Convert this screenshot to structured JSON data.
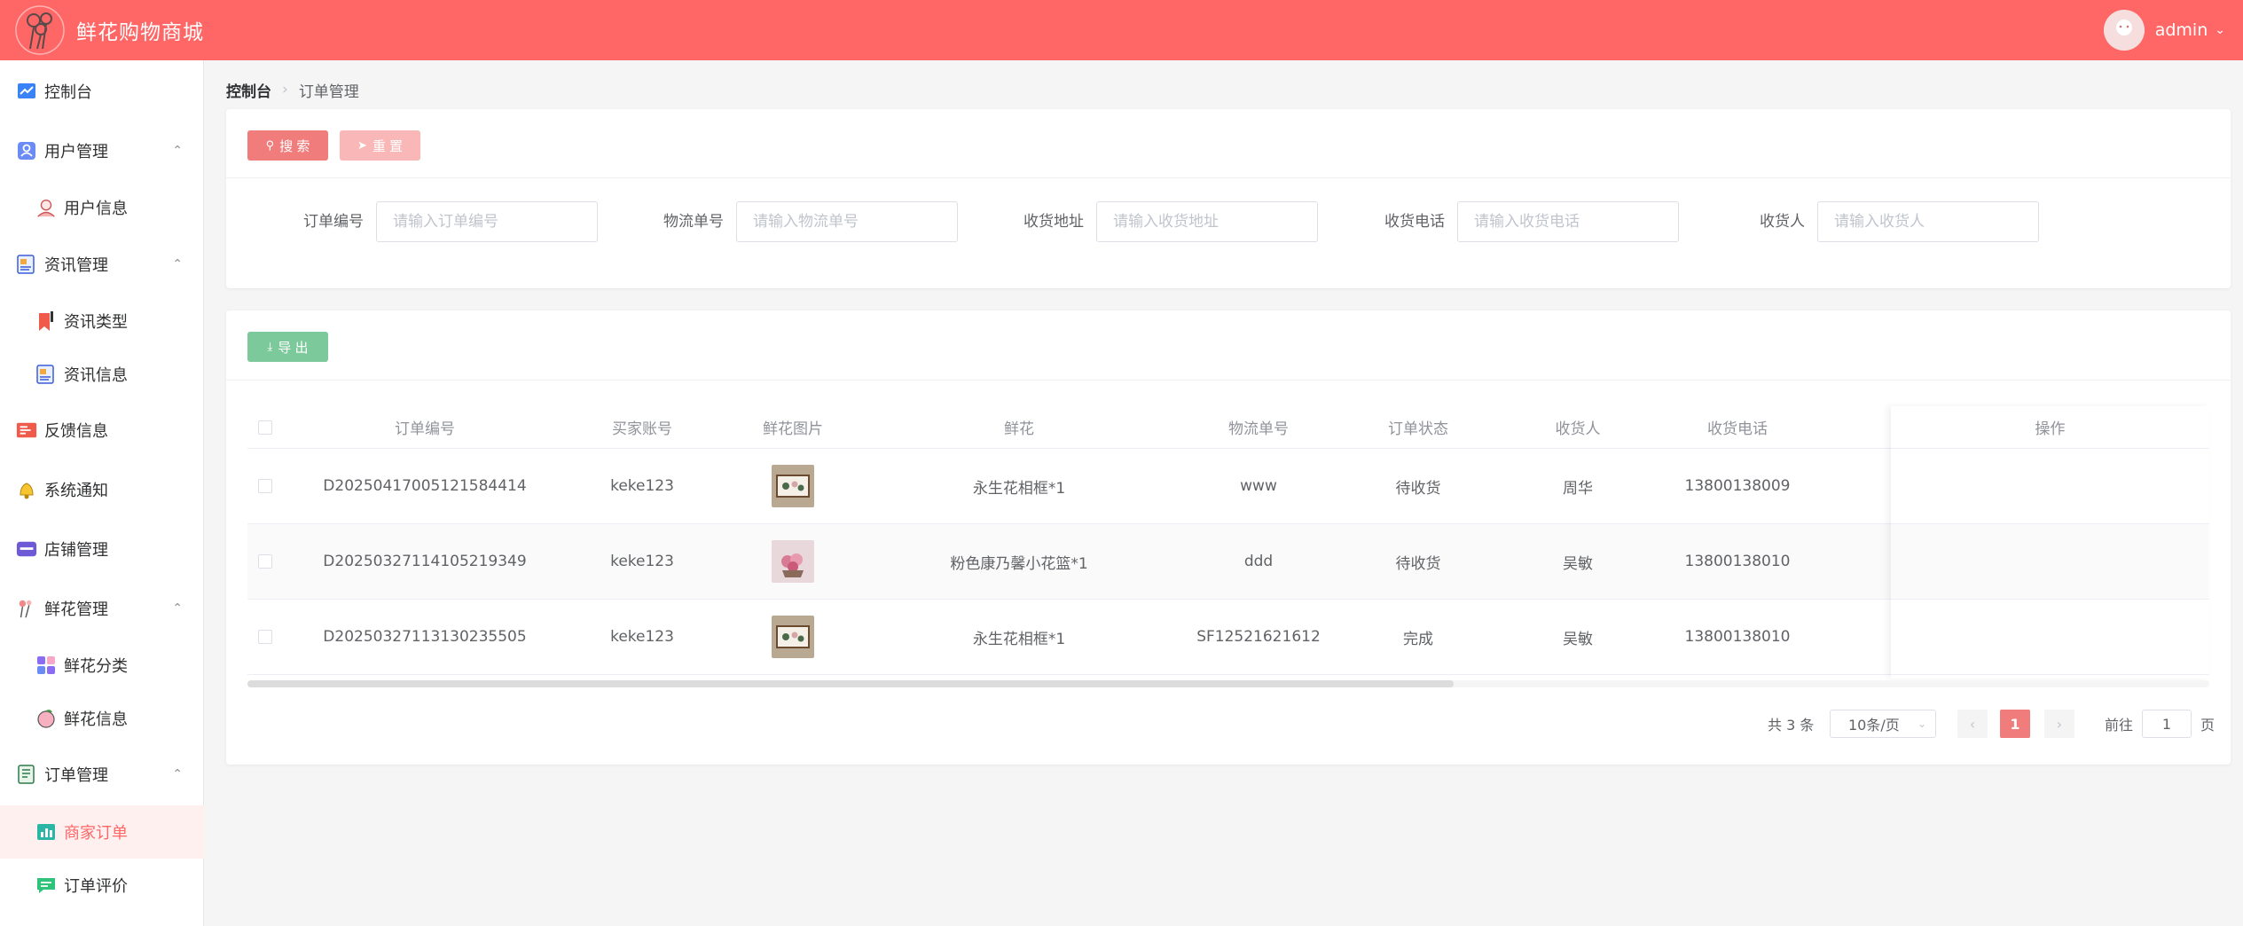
{
  "header": {
    "title": "鲜花购物商城",
    "user": "admin",
    "color": "#ff6666"
  },
  "sidebar": {
    "items": [
      {
        "label": "控制台",
        "icon": "chart-line-icon"
      },
      {
        "label": "用户管理",
        "icon": "user-group-icon"
      },
      {
        "label": "用户信息",
        "icon": "user-avatar-icon"
      },
      {
        "label": "资讯管理",
        "icon": "news-icon"
      },
      {
        "label": "资讯类型",
        "icon": "bookmark-icon"
      },
      {
        "label": "资讯信息",
        "icon": "news-info-icon"
      },
      {
        "label": "反馈信息",
        "icon": "feedback-icon"
      },
      {
        "label": "系统通知",
        "icon": "bell-icon"
      },
      {
        "label": "店铺管理",
        "icon": "store-icon"
      },
      {
        "label": "鲜花管理",
        "icon": "flower-icon"
      },
      {
        "label": "鲜花分类",
        "icon": "category-icon"
      },
      {
        "label": "鲜花信息",
        "icon": "peach-icon"
      },
      {
        "label": "订单管理",
        "icon": "order-list-icon"
      },
      {
        "label": "商家订单",
        "icon": "bar-chart-icon"
      },
      {
        "label": "订单评价",
        "icon": "comment-icon"
      }
    ]
  },
  "breadcrumb": {
    "home": "控制台",
    "current": "订单管理"
  },
  "search": {
    "search_label": "搜 索",
    "reset_label": "重 置",
    "fields": [
      {
        "label": "订单编号",
        "placeholder": "请输入订单编号"
      },
      {
        "label": "物流单号",
        "placeholder": "请输入物流单号"
      },
      {
        "label": "收货地址",
        "placeholder": "请输入收货地址"
      },
      {
        "label": "收货电话",
        "placeholder": "请输入收货电话"
      },
      {
        "label": "收货人",
        "placeholder": "请输入收货人"
      }
    ]
  },
  "table": {
    "export_label": "导 出",
    "headers": {
      "order_no": "订单编号",
      "buyer": "买家账号",
      "image": "鲜花图片",
      "flower": "鲜花",
      "logistics": "物流单号",
      "status": "订单状态",
      "receiver": "收货人",
      "phone": "收货电话",
      "action": "操作"
    },
    "rows": [
      {
        "order_no": "D20250417005121584414",
        "buyer": "keke123",
        "flower": "永生花相框*1",
        "logistics": "www",
        "status": "待收货",
        "receiver": "周华",
        "phone": "13800138009"
      },
      {
        "order_no": "D20250327114105219349",
        "buyer": "keke123",
        "flower": "粉色康乃馨小花篮*1",
        "logistics": "ddd",
        "status": "待收货",
        "receiver": "吴敏",
        "phone": "13800138010"
      },
      {
        "order_no": "D20250327113130235505",
        "buyer": "keke123",
        "flower": "永生花相框*1",
        "logistics": "SF12521621612",
        "status": "完成",
        "receiver": "吴敏",
        "phone": "13800138010"
      }
    ]
  },
  "pagination": {
    "total": "共 3 条",
    "page_size": "10条/页",
    "current_page": "1",
    "goto_prefix": "前往",
    "goto_value": "1",
    "goto_suffix": "页"
  }
}
